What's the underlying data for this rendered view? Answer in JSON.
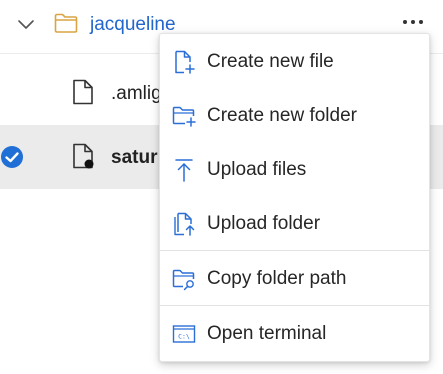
{
  "tree": {
    "folder": {
      "label": "jacqueline",
      "expanded": true,
      "icon": "folder-icon",
      "chevron_icon": "chevron-down-icon",
      "more_icon": "more-horizontal-icon"
    },
    "files": [
      {
        "label": ".amlig",
        "icon": "file-icon",
        "selected": false
      },
      {
        "label": "satur",
        "icon": "file-modified-icon",
        "selected": true,
        "bold": true
      }
    ]
  },
  "context_menu": {
    "items": [
      {
        "label": "Create new file",
        "icon": "new-file-icon"
      },
      {
        "label": "Create new folder",
        "icon": "new-folder-icon"
      },
      {
        "label": "Upload files",
        "icon": "upload-icon"
      },
      {
        "label": "Upload folder",
        "icon": "upload-folder-icon"
      },
      {
        "label": "Copy folder path",
        "icon": "copy-folder-path-icon"
      },
      {
        "label": "Open terminal",
        "icon": "terminal-icon"
      }
    ]
  },
  "colors": {
    "accent": "#2266cc",
    "folder_icon": "#d9a441",
    "menu_icon": "#2a6fd6",
    "selected_row": "#ebebeb",
    "check_badge": "#1f6fd6"
  }
}
